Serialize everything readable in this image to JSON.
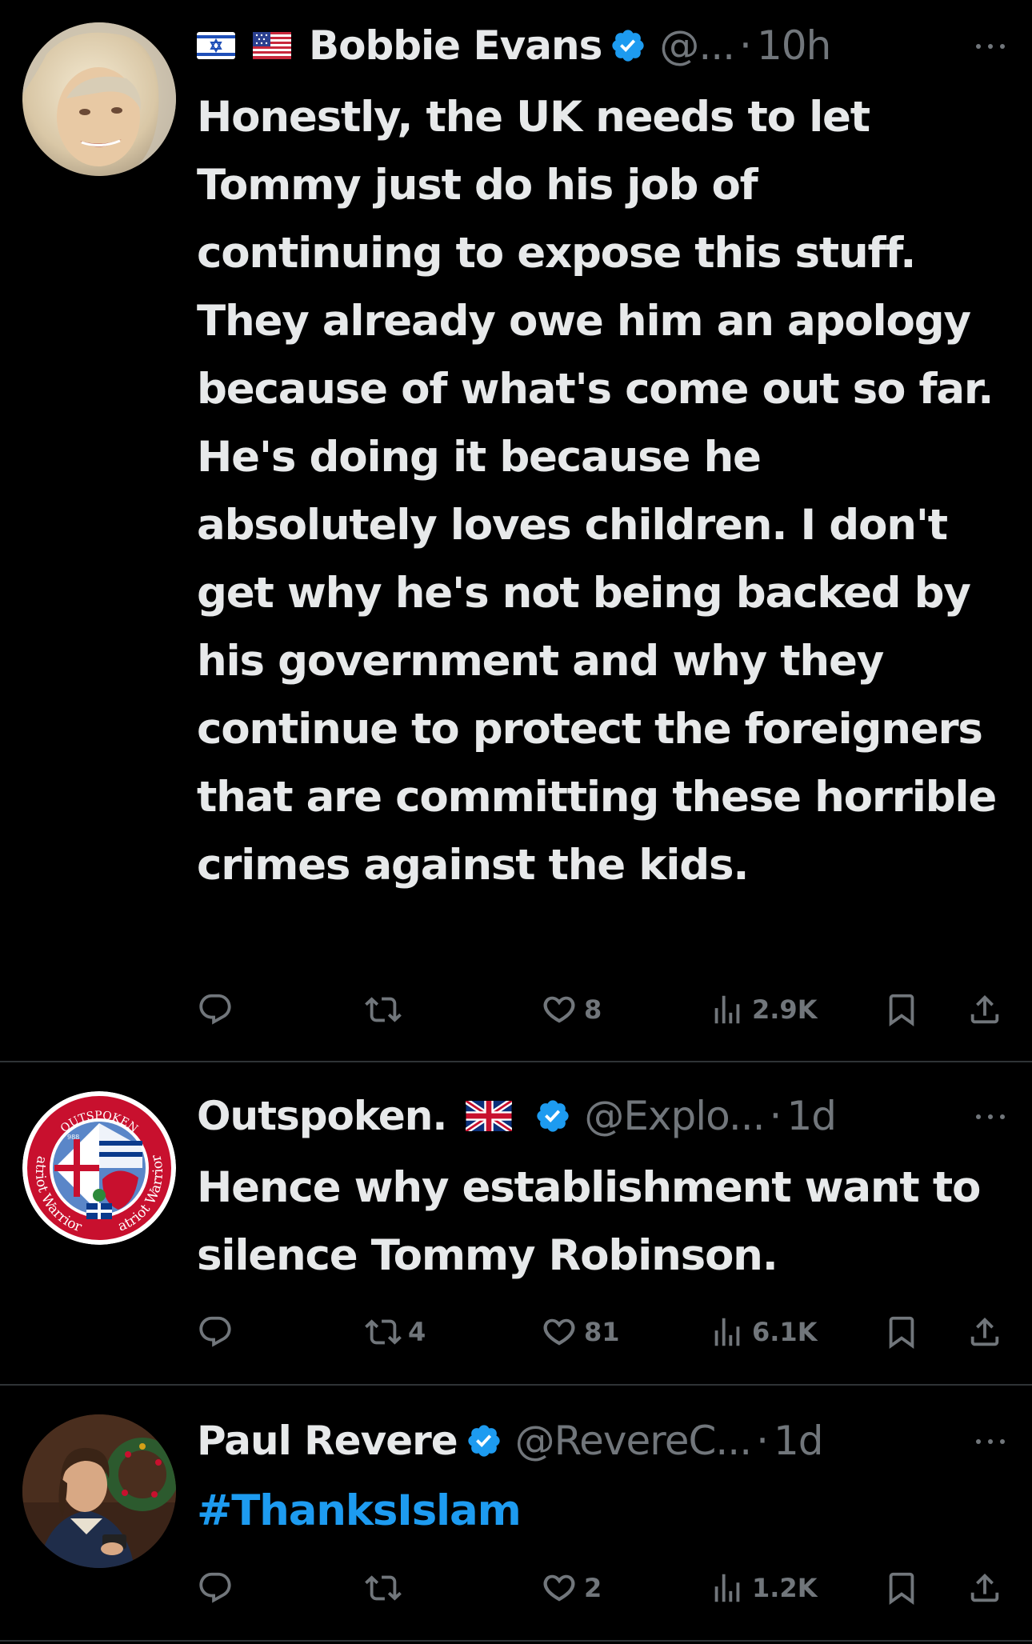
{
  "tweets": [
    {
      "name": "Bobbie Evans",
      "handle": "@...",
      "time": "10h",
      "flags": [
        "israel-flag",
        "us-flag"
      ],
      "verified": true,
      "text": "Honestly, the UK needs to let Tommy just do his job of continuing to expose this stuff. They already owe him an apology because of what's come out so far. He's doing it because he absolutely loves children. I don't get why he's not being backed by his government and why they continue to protect the foreigners that are committing these horrible crimes against the kids.",
      "replies": "",
      "reposts": "",
      "likes": "8",
      "views": "2.9K"
    },
    {
      "name": "Outspoken.",
      "handle": "@Explo...",
      "time": "1d",
      "flags": [
        "uk-flag"
      ],
      "verified": true,
      "text": "Hence why establishment want to silence Tommy Robinson.",
      "replies": "",
      "reposts": "4",
      "likes": "81",
      "views": "6.1K",
      "avatar_text": {
        "top": "OUTSPOKEN",
        "left": "Patriot Warriors",
        "right": "Patriot Warriors",
        "number": "988"
      }
    },
    {
      "name": "Paul Revere",
      "handle": "@RevereC...",
      "time": "1d",
      "flags": [],
      "verified": true,
      "text": "#ThanksIslam",
      "replies": "",
      "reposts": "",
      "likes": "2",
      "views": "1.2K"
    }
  ],
  "colors": {
    "background": "#000000",
    "text": "#e7e9ea",
    "muted": "#71767b",
    "accent": "#1d9bf0",
    "divider": "#2f3336"
  },
  "icons": [
    "reply-icon",
    "repost-icon",
    "like-icon",
    "views-icon",
    "bookmark-icon",
    "share-icon",
    "more-icon",
    "verified-badge-icon"
  ]
}
